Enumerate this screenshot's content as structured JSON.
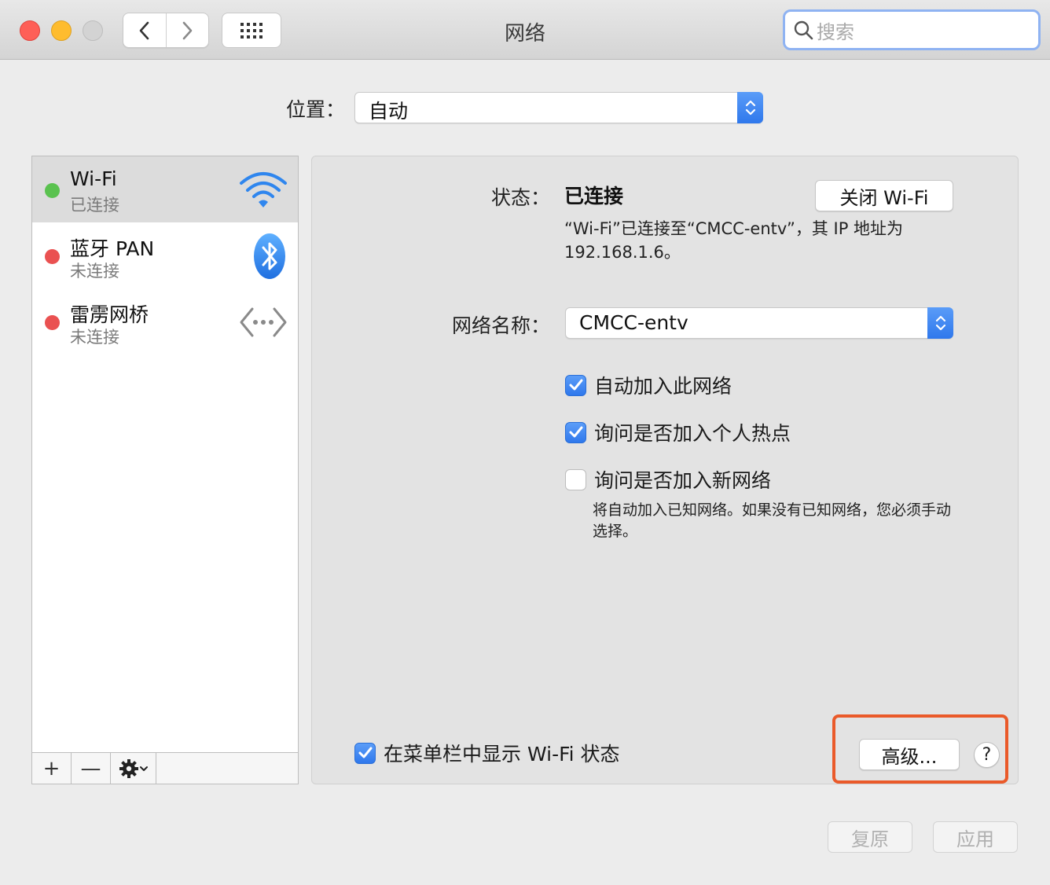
{
  "window": {
    "title": "网络",
    "search_placeholder": "搜索"
  },
  "location": {
    "label": "位置：",
    "value": "自动"
  },
  "sidebar": {
    "services": [
      {
        "name": "Wi-Fi",
        "status": "已连接",
        "dot_color": "#5ac24f",
        "icon": "wifi-icon",
        "selected": true
      },
      {
        "name": "蓝牙 PAN",
        "status": "未连接",
        "dot_color": "#ea5151",
        "icon": "bluetooth-icon",
        "selected": false
      },
      {
        "name": "雷雳网桥",
        "status": "未连接",
        "dot_color": "#ea5151",
        "icon": "thunderbolt-bridge-icon",
        "selected": false
      }
    ],
    "toolbar": {
      "add": "+",
      "remove": "—"
    }
  },
  "panel": {
    "status_label": "状态：",
    "status_value": "已连接",
    "turn_off_button": "关闭 Wi-Fi",
    "status_desc": "“Wi-Fi”已连接至“CMCC-entv”，其 IP 地址为 192.168.1.6。",
    "network_name_label": "网络名称：",
    "network_name_value": "CMCC-entv",
    "checkboxes": [
      {
        "label": "自动加入此网络",
        "checked": true
      },
      {
        "label": "询问是否加入个人热点",
        "checked": true
      },
      {
        "label": "询问是否加入新网络",
        "checked": false
      }
    ],
    "new_network_note": "将自动加入已知网络。如果没有已知网络，您必须手动选择。",
    "menubar_checkbox": {
      "label": "在菜单栏中显示 Wi-Fi 状态",
      "checked": true
    },
    "advanced_button": "高级...",
    "help_button": "?"
  },
  "footer": {
    "revert_button": "复原",
    "apply_button": "应用"
  },
  "colors": {
    "accent": "#2f78ec",
    "highlight": "#ea5a2a"
  }
}
